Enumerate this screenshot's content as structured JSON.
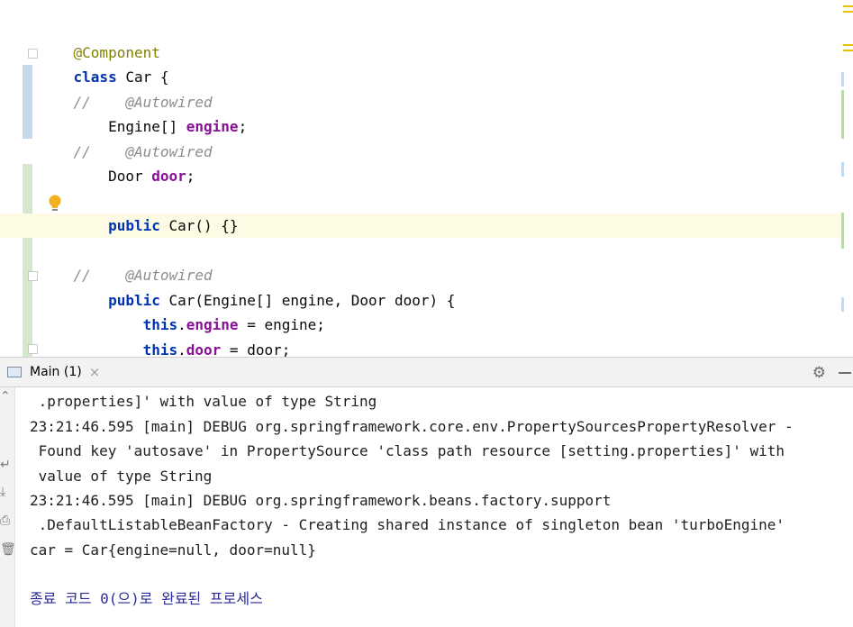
{
  "editor": {
    "lines": {
      "annotation": "@Component",
      "class_kw": "class",
      "class_name": " Car {",
      "c1_slash": "//",
      "c1_ann": "    @Autowired",
      "l4_type": "    Engine[] ",
      "l4_field": "engine",
      "l4_end": ";",
      "c2_slash": "//",
      "c2_ann": "    @Autowired",
      "l6_type": "    Door ",
      "l6_field": "door",
      "l6_end": ";",
      "ctor1_kw": "    public",
      "ctor1_rest": " Car() {}",
      "c3_slash": "//",
      "c3_ann": "    @Autowired",
      "ctor2_kw": "    public",
      "ctor2_rest": " Car(Engine[] engine, Door door) {",
      "a1_kw": "        this",
      "a1_dot": ".",
      "a1_field": "engine",
      "a1_rest": " = engine;",
      "a2_kw": "        this",
      "a2_dot": ".",
      "a2_field": "door",
      "a2_rest": " = door;",
      "close_brace": "    }"
    }
  },
  "run_window": {
    "tab_label": "Main (1)",
    "close_glyph": "×",
    "settings_icon": "gear-icon",
    "console_lines": [
      " .properties]' with value of type String",
      "23:21:46.595 [main] DEBUG org.springframework.core.env.PropertySourcesPropertyResolver -",
      " Found key 'autosave' in PropertySource 'class path resource [setting.properties]' with",
      " value of type String",
      "23:21:46.595 [main] DEBUG org.springframework.beans.factory.support",
      " .DefaultListableBeanFactory - Creating shared instance of singleton bean 'turboEngine'",
      "car = Car{engine=null, door=null}",
      "",
      "종료 코드 0(으)로 완료된 프로세스"
    ]
  },
  "colors": {
    "keyword": "#0033b3",
    "annotation": "#808000",
    "comment": "#8c8c8c",
    "field": "#871094",
    "caret_line": "#fdfbe3",
    "vcs_modified": "#c5d8ec",
    "vcs_added": "#d5e8cd"
  }
}
